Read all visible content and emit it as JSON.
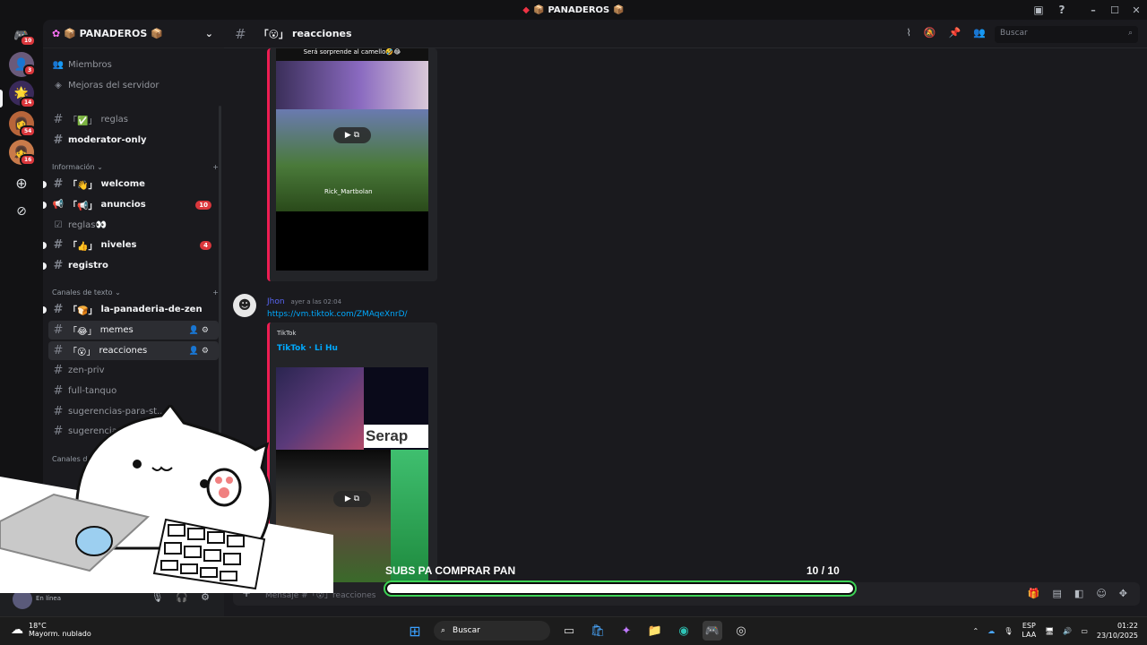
{
  "window": {
    "title": "PANADEROS",
    "controls": [
      "–",
      "☐",
      "✕"
    ]
  },
  "rail": {
    "badges": [
      "10",
      "3",
      "14",
      "54",
      "16"
    ]
  },
  "server": {
    "name": "PANADEROS",
    "chevron": "⌄"
  },
  "sidebar": {
    "top_items": [
      "Miembros",
      "Mejoras del servidor"
    ],
    "pinned": [
      {
        "label": "reglas",
        "emoji": "✅"
      },
      {
        "label": "moderator-only"
      }
    ],
    "cat_info": "Información",
    "info_channels": [
      {
        "label": "welcome",
        "emoji": "👋"
      },
      {
        "label": "anuncios",
        "emoji": "📢",
        "count": "10"
      },
      {
        "label": "reglas",
        "emoji": "👀"
      },
      {
        "label": "niveles",
        "emoji": "👍",
        "count": "4"
      },
      {
        "label": "registro"
      }
    ],
    "cat_text": "Canales de texto",
    "text_channels": [
      {
        "label": "la-panaderia-de-zen",
        "emoji": "🍞"
      },
      {
        "label": "memes",
        "emoji": "😂"
      },
      {
        "label": "reacciones",
        "emoji": "😮"
      },
      {
        "label": "zen-priv"
      },
      {
        "label": "full-tanquo"
      },
      {
        "label": "sugerencias-para-st..."
      },
      {
        "label": "sugerencias"
      }
    ],
    "cat_voice": "Canales d"
  },
  "channel": {
    "name": "reacciones",
    "emoji": "😮"
  },
  "header": {
    "search_placeholder": "Buscar"
  },
  "messages": {
    "first_embed_caption": "Será sorprende al camello🤣😂",
    "first_embed_overlay": "Rick_Martbolan",
    "author": "Jhon",
    "time": "ayer a las 02:04",
    "link": "https://vm.tiktok.com/ZMAqeXnrD/",
    "embed_provider": "TikTok",
    "embed_title": "TikTok · Li Hu",
    "embed_overlay_text": "Serap"
  },
  "composer": {
    "placeholder": "Mensaje #「😮」reacciones"
  },
  "stream_overlay": {
    "goal_label": "SUBS PA COMPRAR PAN",
    "current": "10",
    "separator": "/",
    "target": "10",
    "progress": 1.0
  },
  "user_panel": {
    "status": "En línea"
  },
  "taskbar": {
    "temp": "18°C",
    "weather": "Mayorm. nublado",
    "search": "Buscar",
    "lang1": "ESP",
    "lang2": "LAA",
    "time": "01:22",
    "date": "23/10/2025"
  }
}
